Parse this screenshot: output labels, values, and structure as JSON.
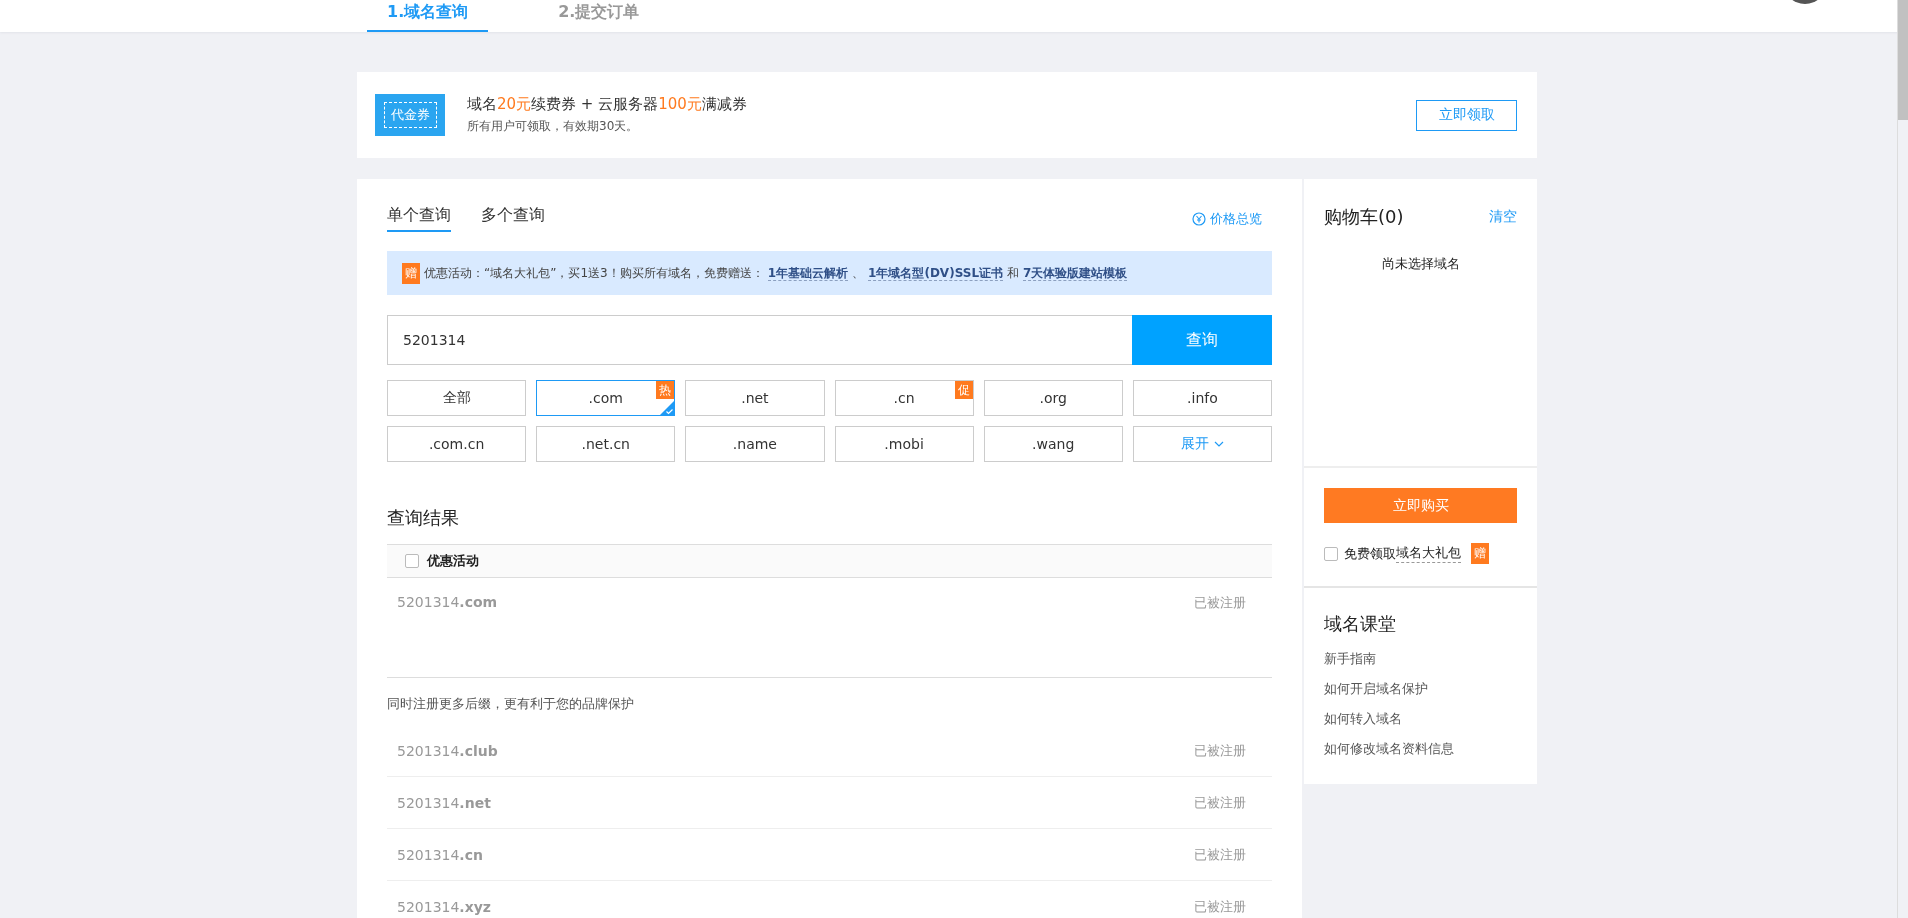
{
  "steps": [
    {
      "label": "1.域名查询",
      "selected": true
    },
    {
      "label": "2.提交订单",
      "selected": false
    }
  ],
  "coupon": {
    "badge": "代金券",
    "title": [
      {
        "text": "域名",
        "highlight": false
      },
      {
        "text": "20元",
        "highlight": true
      },
      {
        "text": "续费券 + 云服务器",
        "highlight": false
      },
      {
        "text": "100元",
        "highlight": true
      },
      {
        "text": "满减券",
        "highlight": false
      }
    ],
    "subtitle": "所有用户可领取，有效期30天。",
    "button": "立即领取"
  },
  "query_tabs": [
    {
      "label": "单个查询",
      "selected": true
    },
    {
      "label": "多个查询",
      "selected": false
    }
  ],
  "price_link": "价格总览",
  "promo": {
    "badge": "赠",
    "parts": [
      {
        "kind": "text",
        "text": "优惠活动：“域名大礼包”，买1送3！购买所有域名，免费赠送："
      },
      {
        "kind": "link",
        "text": "1年基础云解析"
      },
      {
        "kind": "text",
        "text": "、"
      },
      {
        "kind": "link",
        "text": "1年域名型(DV)SSL证书"
      },
      {
        "kind": "text",
        "text": "和"
      },
      {
        "kind": "link",
        "text": "7天体验版建站模板"
      }
    ]
  },
  "search": {
    "value": "5201314",
    "button": "查询"
  },
  "tlds": [
    {
      "label": "全部",
      "selected": false,
      "kind": "option"
    },
    {
      "label": ".com",
      "selected": true,
      "kind": "option",
      "badge": "热"
    },
    {
      "label": ".net",
      "selected": false,
      "kind": "option"
    },
    {
      "label": ".cn",
      "selected": false,
      "kind": "option",
      "badge": "促"
    },
    {
      "label": ".org",
      "selected": false,
      "kind": "option"
    },
    {
      "label": ".info",
      "selected": false,
      "kind": "option"
    },
    {
      "label": ".com.cn",
      "selected": false,
      "kind": "option"
    },
    {
      "label": ".net.cn",
      "selected": false,
      "kind": "option"
    },
    {
      "label": ".name",
      "selected": false,
      "kind": "option"
    },
    {
      "label": ".mobi",
      "selected": false,
      "kind": "option"
    },
    {
      "label": ".wang",
      "selected": false,
      "kind": "option"
    },
    {
      "label": "展开",
      "selected": false,
      "kind": "expand"
    }
  ],
  "results": {
    "title": "查询结果",
    "filter": {
      "label": "优惠活动",
      "checked": false
    },
    "rows": [
      {
        "domain": "5201314**.com**",
        "status": "已被注册"
      }
    ],
    "more_note": "同时注册更多后缀，更有利于您的品牌保护",
    "more_rows": [
      {
        "domain": "5201314**.club**",
        "status": "已被注册"
      },
      {
        "domain": "5201314**.net**",
        "status": "已被注册"
      },
      {
        "domain": "5201314**.cn**",
        "status": "已被注册"
      },
      {
        "domain": "5201314**.xyz**",
        "status": "已被注册"
      }
    ]
  },
  "cart": {
    "title": "购物车(0)",
    "clear": "清空",
    "empty": "尚未选择域名",
    "buy": "立即购买",
    "gift": {
      "label": "免费领取",
      "link": "域名大礼包",
      "checked": false,
      "badge": "赠"
    }
  },
  "course": {
    "title": "域名课堂",
    "links": [
      "新手指南",
      "如何开启域名保护",
      "如何转入域名",
      "如何修改域名资料信息"
    ]
  }
}
